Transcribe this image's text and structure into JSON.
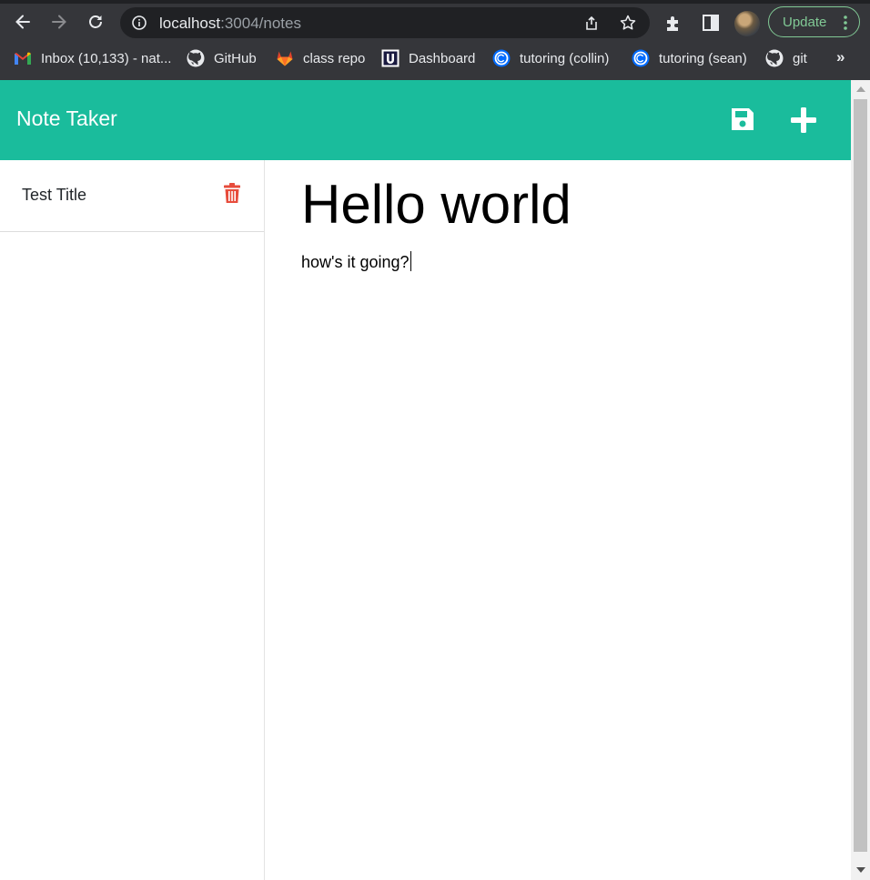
{
  "browser": {
    "url_host": "localhost",
    "url_path": ":3004/notes",
    "nav_icons": [
      "back-arrow-icon",
      "forward-arrow-icon",
      "reload-icon"
    ],
    "update_label": "Update",
    "accent_color": "#81c995",
    "bookmarks": [
      {
        "label": "Inbox (10,133) - nat...",
        "icon": "gmail-icon"
      },
      {
        "label": "GitHub",
        "icon": "github-icon"
      },
      {
        "label": "class repo",
        "icon": "gitlab-icon"
      },
      {
        "label": "Dashboard",
        "icon": "dashboard-icon"
      },
      {
        "label": "tutoring (collin)",
        "icon": "calendly-icon"
      },
      {
        "label": "tutoring (sean)",
        "icon": "calendly-icon"
      },
      {
        "label": "git",
        "icon": "github-icon"
      }
    ],
    "bookmarks_overflow": "»"
  },
  "app": {
    "brand": "Note Taker",
    "brand_color": "#1abc9c",
    "toolbar_icons": [
      "save-icon",
      "plus-icon"
    ],
    "notes": [
      {
        "title": "Test Title",
        "action_icon": "trash-icon",
        "action_color": "#e74c3c"
      }
    ],
    "editor": {
      "title": "Hello world",
      "text": "how's it going?"
    }
  }
}
